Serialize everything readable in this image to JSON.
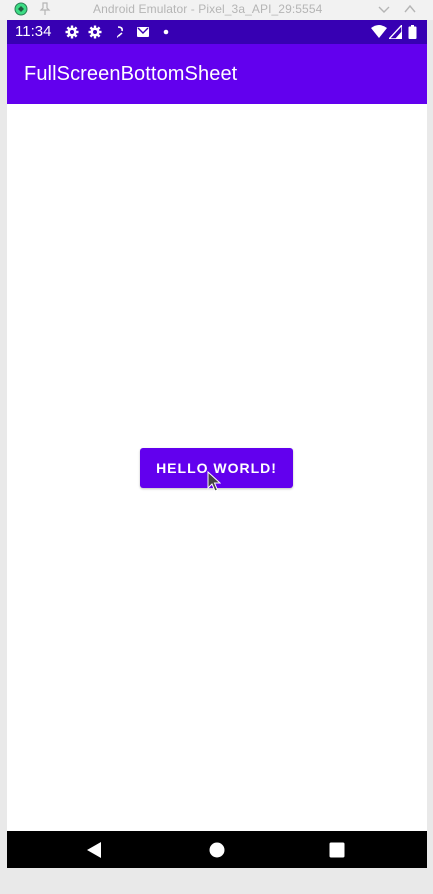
{
  "window": {
    "title": "Android Emulator - Pixel_3a_API_29:5554"
  },
  "status_bar": {
    "time": "11:34"
  },
  "app_bar": {
    "title": "FullScreenBottomSheet"
  },
  "main": {
    "button_label": "HELLO WORLD!"
  },
  "colors": {
    "primary": "#6200ee",
    "primary_dark": "#3700b3",
    "nav_bar": "#000000"
  },
  "icons": {
    "window": [
      "emulator-app-icon",
      "pin-icon",
      "chevron-down-icon",
      "close-icon"
    ],
    "status_left": [
      "gear-icon",
      "gear-icon",
      "sync-icon",
      "mail-icon",
      "dot-icon"
    ],
    "status_right": [
      "wifi-icon",
      "signal-icon",
      "battery-icon"
    ],
    "nav": [
      "back-icon",
      "home-icon",
      "recents-icon"
    ]
  }
}
